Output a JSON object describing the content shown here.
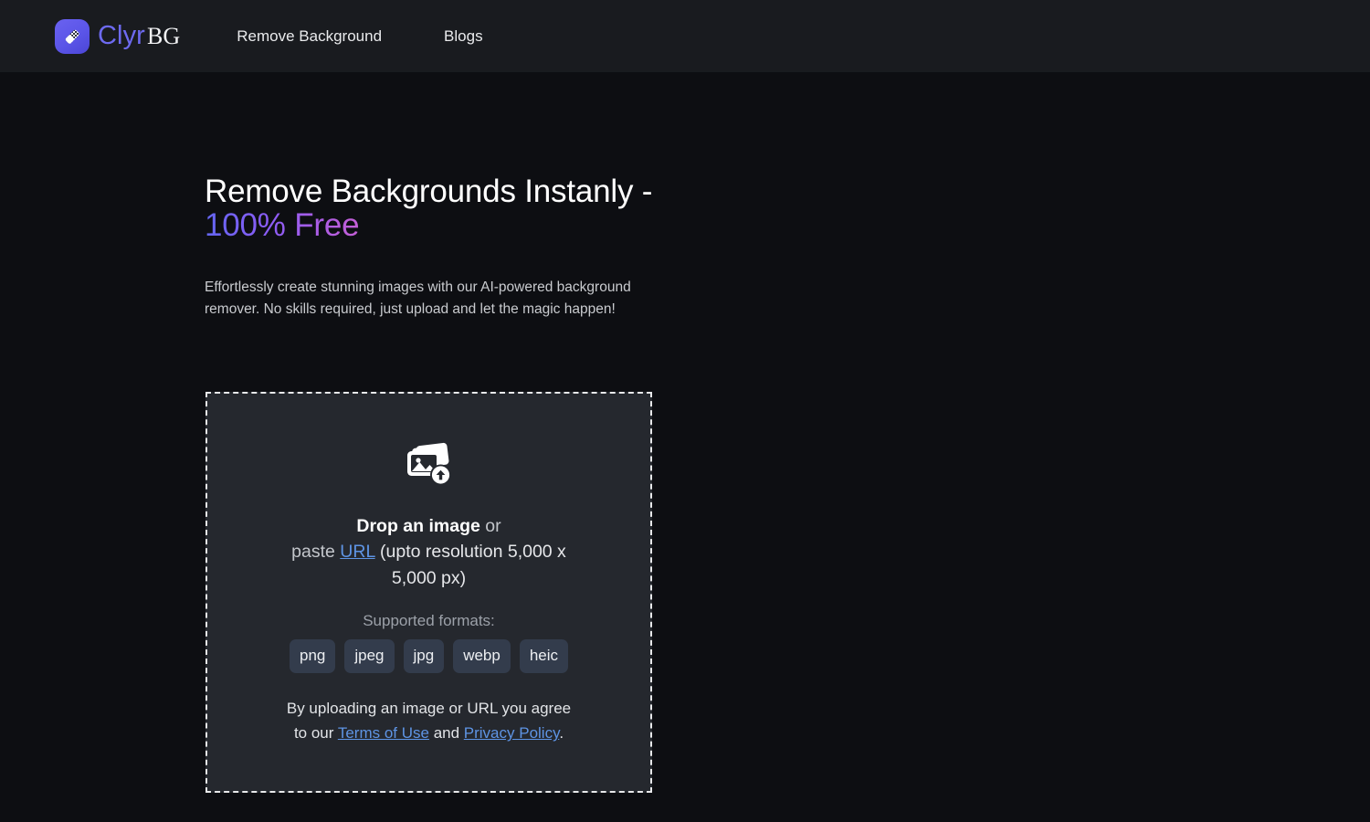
{
  "brand": {
    "logo_icon": "eraser-checker-icon",
    "name_primary": "Clyr",
    "name_secondary": "BG",
    "accent_color": "#6d6af0",
    "mark_color": "#5b55e8"
  },
  "nav": {
    "items": [
      {
        "label": "Remove Background"
      },
      {
        "label": "Blogs"
      }
    ]
  },
  "hero": {
    "title_line1": "Remove Backgrounds Instanly -",
    "title_accent": "100% Free",
    "accent_gradient_from": "#6366f1",
    "accent_gradient_to": "#c45ed6",
    "subtitle": "Effortlessly create stunning images with our AI-powered background remover. No skills required, just upload and let the magic happen!"
  },
  "dropzone": {
    "icon": "image-upload-icon",
    "headline_strong": "Drop an image",
    "headline_or": " or",
    "paste_prefix": "paste ",
    "paste_link": "URL",
    "paste_suffix": " (upto resolution 5,000 x 5,000 px)",
    "formats_label": "Supported formats:",
    "formats": [
      "png",
      "jpeg",
      "jpg",
      "webp",
      "heic"
    ],
    "terms_prefix": "By uploading an image or URL you agree to our ",
    "terms_link": "Terms of Use",
    "terms_middle": " and ",
    "privacy_link": "Privacy Policy",
    "terms_suffix": ".",
    "link_color": "#5e94e4",
    "background": "#25282e",
    "border_color": "#e8e9eb"
  }
}
